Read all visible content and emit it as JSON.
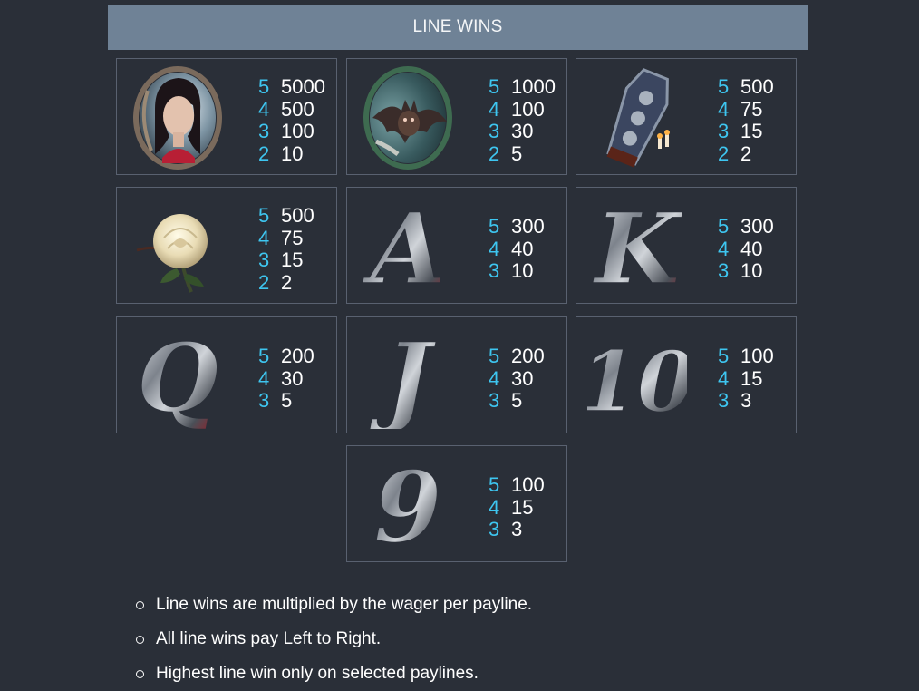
{
  "header": {
    "title": "LINE WINS"
  },
  "symbols": [
    {
      "name": "woman-portrait",
      "icon": "woman-portrait-icon",
      "pays": [
        {
          "count": "5",
          "amount": "5000"
        },
        {
          "count": "4",
          "amount": "500"
        },
        {
          "count": "3",
          "amount": "100"
        },
        {
          "count": "2",
          "amount": "10"
        }
      ]
    },
    {
      "name": "bat-portrait",
      "icon": "bat-portrait-icon",
      "pays": [
        {
          "count": "5",
          "amount": "1000"
        },
        {
          "count": "4",
          "amount": "100"
        },
        {
          "count": "3",
          "amount": "30"
        },
        {
          "count": "2",
          "amount": "5"
        }
      ]
    },
    {
      "name": "coffin",
      "icon": "coffin-icon",
      "pays": [
        {
          "count": "5",
          "amount": "500"
        },
        {
          "count": "4",
          "amount": "75"
        },
        {
          "count": "3",
          "amount": "15"
        },
        {
          "count": "2",
          "amount": "2"
        }
      ]
    },
    {
      "name": "white-rose",
      "icon": "white-rose-icon",
      "pays": [
        {
          "count": "5",
          "amount": "500"
        },
        {
          "count": "4",
          "amount": "75"
        },
        {
          "count": "3",
          "amount": "15"
        },
        {
          "count": "2",
          "amount": "2"
        }
      ]
    },
    {
      "name": "letter-a",
      "icon": "letter-a-icon",
      "glyph": "A",
      "pays": [
        {
          "count": "5",
          "amount": "300"
        },
        {
          "count": "4",
          "amount": "40"
        },
        {
          "count": "3",
          "amount": "10"
        }
      ]
    },
    {
      "name": "letter-k",
      "icon": "letter-k-icon",
      "glyph": "K",
      "pays": [
        {
          "count": "5",
          "amount": "300"
        },
        {
          "count": "4",
          "amount": "40"
        },
        {
          "count": "3",
          "amount": "10"
        }
      ]
    },
    {
      "name": "letter-q",
      "icon": "letter-q-icon",
      "glyph": "Q",
      "pays": [
        {
          "count": "5",
          "amount": "200"
        },
        {
          "count": "4",
          "amount": "30"
        },
        {
          "count": "3",
          "amount": "5"
        }
      ]
    },
    {
      "name": "letter-j",
      "icon": "letter-j-icon",
      "glyph": "J",
      "pays": [
        {
          "count": "5",
          "amount": "200"
        },
        {
          "count": "4",
          "amount": "30"
        },
        {
          "count": "3",
          "amount": "5"
        }
      ]
    },
    {
      "name": "number-10",
      "icon": "number-10-icon",
      "glyph": "10",
      "pays": [
        {
          "count": "5",
          "amount": "100"
        },
        {
          "count": "4",
          "amount": "15"
        },
        {
          "count": "3",
          "amount": "3"
        }
      ]
    },
    {
      "name": "number-9",
      "icon": "number-9-icon",
      "glyph": "9",
      "pays": [
        {
          "count": "5",
          "amount": "100"
        },
        {
          "count": "4",
          "amount": "15"
        },
        {
          "count": "3",
          "amount": "3"
        }
      ]
    }
  ],
  "notes": [
    "Line wins are multiplied by the wager per payline.",
    "All line wins pay Left to Right.",
    "Highest line win only on selected paylines."
  ],
  "colors": {
    "background": "#2a2f38",
    "header": "#6f8296",
    "count": "#3ec6f0",
    "border": "#596170"
  }
}
